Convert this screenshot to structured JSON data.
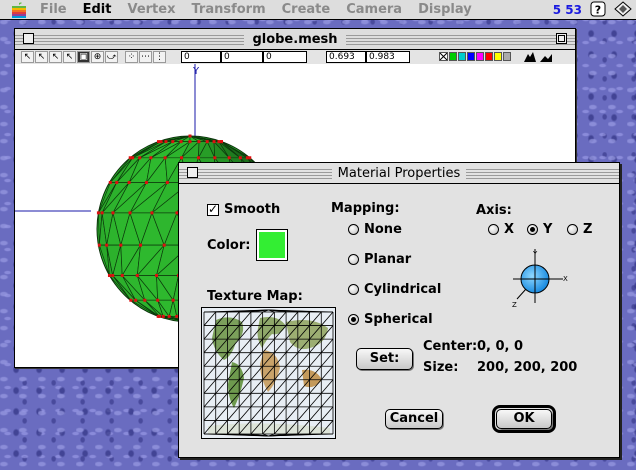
{
  "menubar": {
    "items": [
      "File",
      "Edit",
      "Vertex",
      "Transform",
      "Create",
      "Camera",
      "Display"
    ],
    "enabled_item": "Edit",
    "clock": "5 53"
  },
  "mesh_window": {
    "title": "globe.mesh",
    "coords": [
      "0",
      "0",
      "0"
    ],
    "scale": [
      "0.693",
      "0.983"
    ],
    "axis_label_y": "Y",
    "swatch_colors": [
      "#00cc00",
      "#00cccc",
      "#0000ff",
      "#ff00ff",
      "#ff0000",
      "#ffff00",
      "#aaaaaa"
    ],
    "globe_color": "#2db52d",
    "vertex_color": "#dd1111"
  },
  "dialog": {
    "title": "Material Properties",
    "smooth_label": "Smooth",
    "smooth_checked": true,
    "color_label": "Color:",
    "color_value": "#33ee33",
    "mapping_label": "Mapping:",
    "mapping_options": [
      "None",
      "Planar",
      "Cylindrical",
      "Spherical"
    ],
    "mapping_selected": "Spherical",
    "axis_label": "Axis:",
    "axis_options": [
      "X",
      "Y",
      "Z"
    ],
    "axis_selected": "Y",
    "axis_widget_labels": [
      "Y",
      "X",
      "Z"
    ],
    "texture_label": "Texture Map:",
    "set_button": "Set:",
    "center_label": "Center:",
    "center_value": "0, 0, 0",
    "size_label": "Size:",
    "size_value": "200, 200, 200",
    "cancel_button": "Cancel",
    "ok_button": "OK"
  }
}
